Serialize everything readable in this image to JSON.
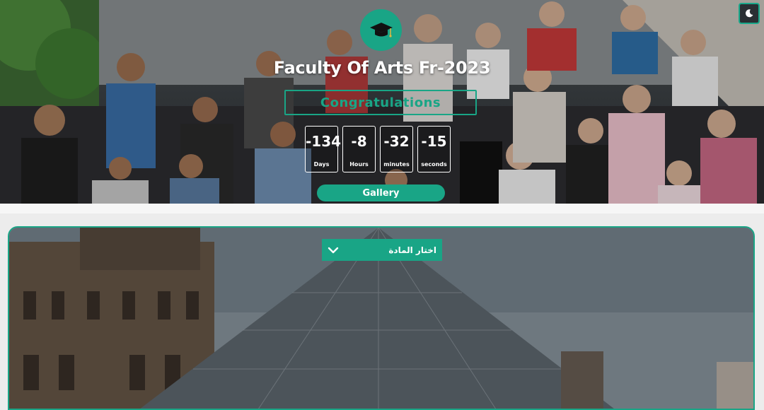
{
  "hero": {
    "title": "Faculty Of Arts Fr-2023",
    "congrats": "Congratulations",
    "countdown": [
      {
        "value": "-134",
        "label": "Days"
      },
      {
        "value": "-8",
        "label": "Hours"
      },
      {
        "value": "-32",
        "label": "minutes"
      },
      {
        "value": "-15",
        "label": "seconds"
      }
    ],
    "gallery_label": "Gallery"
  },
  "subject_select": {
    "label": "اختار المادة"
  },
  "colors": {
    "accent": "#19a586"
  },
  "icons": {
    "theme_toggle": "moon-icon",
    "logo": "graduation-cap-icon",
    "select_arrow": "chevron-down-icon"
  }
}
